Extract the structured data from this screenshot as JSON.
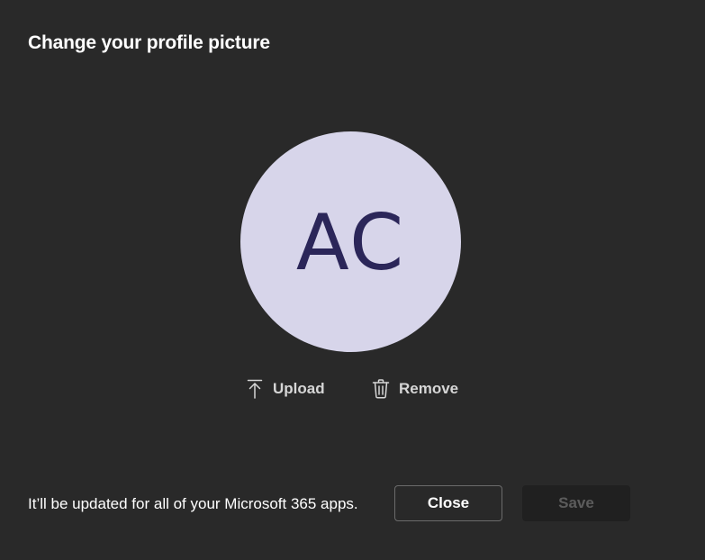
{
  "dialog": {
    "title": "Change your profile picture",
    "avatar": {
      "initials": "AC",
      "background_color": "#d7d5ea",
      "initials_color": "#2b2659"
    },
    "actions": [
      {
        "label": "Upload",
        "icon": "upload-icon"
      },
      {
        "label": "Remove",
        "icon": "trash-icon"
      }
    ],
    "footer_text": "It’ll be updated for all of your Microsoft 365 apps.",
    "buttons": {
      "close_label": "Close",
      "save_label": "Save",
      "save_enabled": false
    }
  },
  "colors": {
    "background": "#292929",
    "text": "#ffffff",
    "action_text": "#d6d6d6",
    "disabled_text": "#5c5c5c"
  }
}
